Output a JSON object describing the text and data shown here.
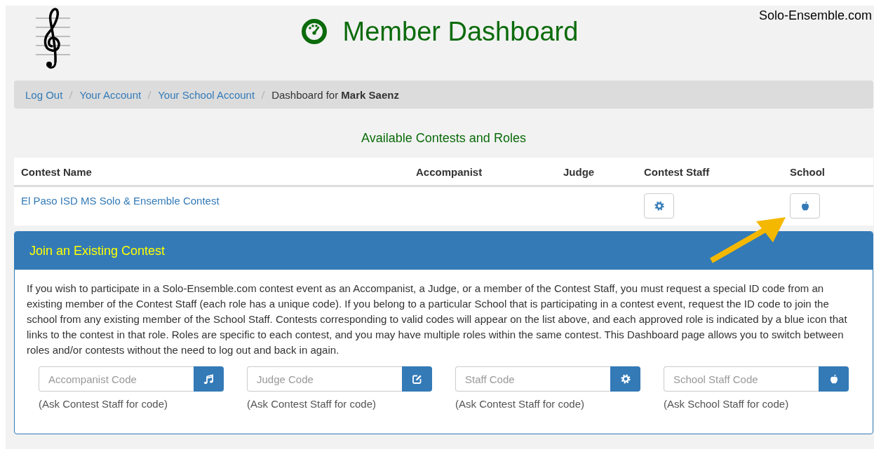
{
  "header": {
    "title": "Member Dashboard",
    "site_name": "Solo-Ensemble.com"
  },
  "breadcrumb": [
    {
      "kind": "link",
      "text": "Log Out"
    },
    {
      "kind": "link",
      "text": "Your Account"
    },
    {
      "kind": "link",
      "text": "Your School Account"
    },
    {
      "kind": "current",
      "text": "Dashboard for **Mark Saenz**"
    }
  ],
  "section_title": "Available Contests and Roles",
  "table": {
    "columns": [
      "Contest Name",
      "Accompanist",
      "Judge",
      "Contest Staff",
      "School"
    ],
    "rows": [
      {
        "contest_name": "El Paso ISD MS Solo & Ensemble Contest",
        "roles": [
          {
            "kind": "none"
          },
          {
            "kind": "none"
          },
          {
            "kind": "gear"
          },
          {
            "kind": "apple"
          }
        ]
      }
    ]
  },
  "join_panel": {
    "title": "Join an Existing Contest",
    "text": "If you wish to participate in a Solo-Ensemble.com contest event as an Accompanist, a Judge, or a member of the Contest Staff, you must request a special ID code from an existing member of the Contest Staff (each role has a unique code). If you belong to a particular School that is participating in a contest event, request the ID code to join the school from any existing member of the School Staff. Contests corresponding to valid codes will appear on the list above, and each approved role is indicated by a blue icon that links to the contest in that role. Roles are specific to each contest, and you may have multiple roles within the same contest. This Dashboard page allows you to switch between roles and/or contests without the need to log out and back in again.",
    "codes": [
      {
        "placeholder": "Accompanist Code",
        "kind": "music",
        "hint": "(Ask Contest Staff for code)"
      },
      {
        "placeholder": "Judge Code",
        "kind": "edit",
        "hint": "(Ask Contest Staff for code)"
      },
      {
        "placeholder": "Staff Code",
        "kind": "gear",
        "hint": "(Ask Contest Staff for code)"
      },
      {
        "placeholder": "School Staff Code",
        "kind": "apple",
        "hint": "(Ask School Staff for code)"
      }
    ]
  }
}
